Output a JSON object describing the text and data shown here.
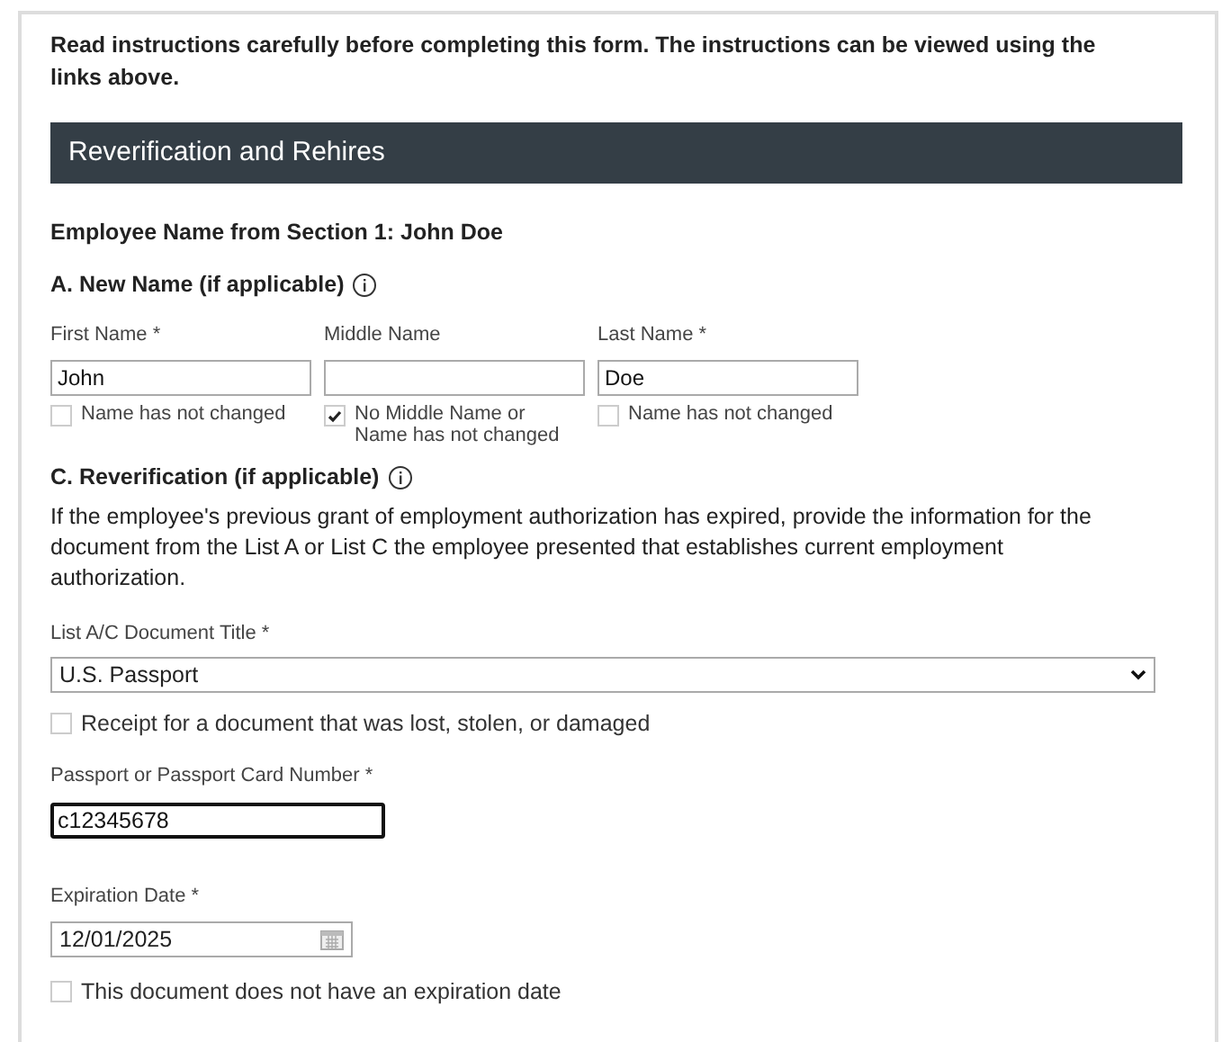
{
  "instructions": "Read instructions carefully before completing this form. The instructions can be viewed using the links above.",
  "section_header": "Reverification and Rehires",
  "employee_name": "Employee Name from Section 1:  John Doe",
  "new_name": {
    "heading": "A. New Name (if applicable)",
    "fields": [
      {
        "label": "First Name *",
        "value": "John",
        "checkbox": {
          "label": "Name has not changed",
          "checked": false
        }
      },
      {
        "label": "Middle Name",
        "checkbox": {
          "label": "No Middle Name or Name has not changed",
          "checked": true
        }
      },
      {
        "label": "Last Name *",
        "value": "Doe",
        "checkbox": {
          "label": "Name has not changed",
          "checked": false
        }
      }
    ]
  },
  "reverification": {
    "heading": "C. Reverification (if applicable)",
    "description": "If the employee's previous grant of employment authorization has expired, provide the information for the document from the List A or List C the employee presented that establishes current employment authorization.",
    "document_title": {
      "label": "List A/C Document Title *",
      "value": "U.S. Passport"
    },
    "receipt": {
      "label": "Receipt for a document that was lost, stolen, or damaged",
      "checked": false
    },
    "document_number": {
      "label": "Passport or Passport Card Number *",
      "value": "c12345678",
      "focused": true
    },
    "expiration_date": {
      "label": "Expiration Date *",
      "value": "12/01/2025"
    },
    "no_expiration": {
      "label": "This document does not have an expiration date",
      "checked": false
    }
  }
}
